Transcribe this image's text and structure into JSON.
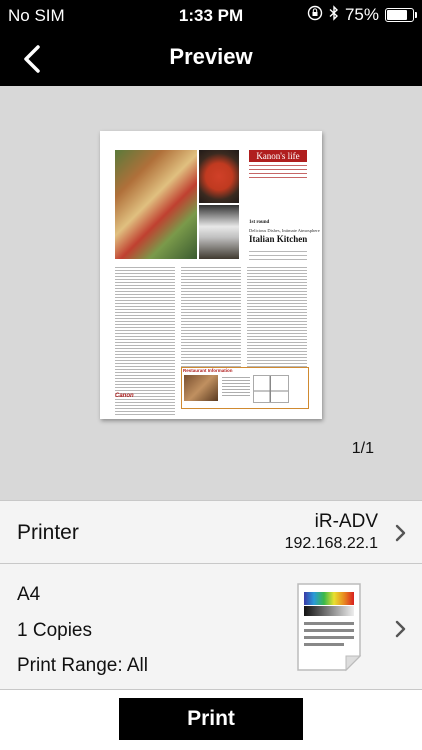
{
  "status_bar": {
    "carrier": "No SIM",
    "time": "1:33 PM",
    "battery_text": "75%",
    "battery_level": 0.75,
    "icons": [
      "rotation-lock-icon",
      "bluetooth-icon",
      "battery-icon"
    ]
  },
  "nav": {
    "title": "Preview",
    "back_icon": "chevron-left-icon"
  },
  "preview": {
    "page_counter": "1/1",
    "document": {
      "masthead": "Kanon's life",
      "tagline": "1st round",
      "subhead": "Delicious Dishes, Intimate Atmosphere",
      "headline": "Italian Kitchen",
      "box_title": "Restaurant Information",
      "brand": "Canon"
    }
  },
  "printer": {
    "label": "Printer",
    "name": "iR-ADV",
    "ip": "192.168.22.1"
  },
  "settings": {
    "paper_size": "A4",
    "copies": "1 Copies",
    "print_range": "Print Range: All"
  },
  "actions": {
    "print_label": "Print"
  },
  "colors": {
    "bar_background": "#000000",
    "preview_background": "#d8d8d8",
    "row_background": "#f4f4f4",
    "masthead_red": "#b01e1e"
  }
}
